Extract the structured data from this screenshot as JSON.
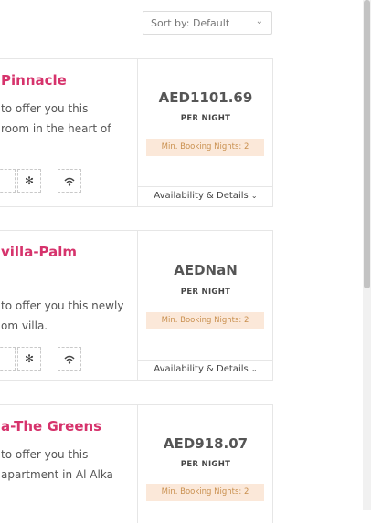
{
  "sort": {
    "label": "Sort by: Default",
    "chevron": "⌄"
  },
  "listings": [
    {
      "title": "Pinnacle",
      "desc_lines": [
        "to offer you this",
        "room in the heart of"
      ],
      "price": "AED1101.69",
      "per_night": "PER NIGHT",
      "min_booking": "Min. Booking Nights: 2",
      "details": "Availability & Details",
      "amenities": [
        "snowflake-icon",
        "wifi-icon"
      ]
    },
    {
      "title": "villa-Palm",
      "desc_lines": [
        "to offer you this newly",
        "om villa."
      ],
      "price": "AEDNaN",
      "per_night": "PER NIGHT",
      "min_booking": "Min. Booking Nights: 2",
      "details": "Availability & Details",
      "amenities": [
        "snowflake-icon",
        "wifi-icon"
      ]
    },
    {
      "title": "a-The Greens",
      "desc_lines": [
        "to offer you this",
        "apartment in Al Alka"
      ],
      "price": "AED918.07",
      "per_night": "PER NIGHT",
      "min_booking": "Min. Booking Nights: 2",
      "details": "",
      "amenities": []
    }
  ],
  "colors": {
    "title": "#d6336c",
    "badge_bg": "#fbe8d9",
    "badge_text": "#c9904f"
  }
}
